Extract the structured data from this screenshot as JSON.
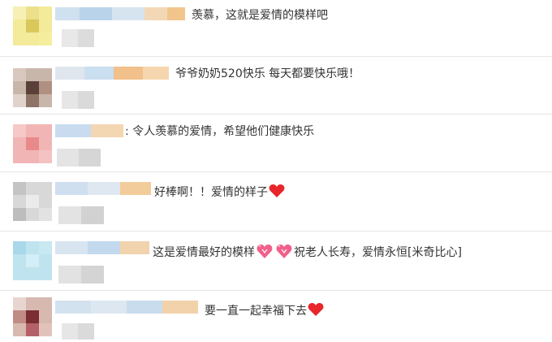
{
  "comments": [
    {
      "text": "羡慕，这就是爱情的模样吧"
    },
    {
      "text": "爷爷奶奶520快乐 每天都要快乐哦！"
    },
    {
      "text": ": 令人羡慕的爱情，希望他们健康快乐"
    },
    {
      "text": "好棒啊！！爱情的样子"
    },
    {
      "text_a": "这是爱情最好的模样",
      "text_b": "祝老人长寿，爱情永恒[米奇比心]"
    },
    {
      "text": "要一直一起幸福下去"
    }
  ],
  "icons": {
    "heart": "red-heart-icon",
    "pink_heart": "sparkling-heart-icon"
  },
  "colors": {
    "divider": "#e6e6e6",
    "heart": "#e8262c",
    "pink_heart": "#f0608a",
    "text": "#333333"
  }
}
